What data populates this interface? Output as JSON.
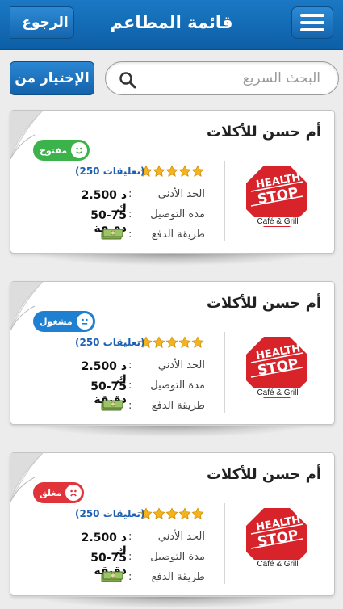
{
  "header": {
    "title": "قائمة المطاعم",
    "back_label": "الرجوع"
  },
  "search": {
    "placeholder": "البحث السريع",
    "choose_label": "الإختيار من"
  },
  "labels": {
    "min_order": "الحد الأدني",
    "delivery_time": "مدة التوصيل",
    "payment": "طريقة الدفع",
    "colon": ":"
  },
  "logo": {
    "line1": "HEALTH",
    "line2": "STOP",
    "line3": "Café & Grill"
  },
  "restaurants": [
    {
      "name": "أم حسن للأكلات",
      "status": "مفتوح",
      "status_color": "#3bb34a",
      "face": "open-smile-icon",
      "rating": 5,
      "comments": "(250 تعليقات)",
      "min_order": "2.500 د ك",
      "delivery_time": "50-75 دقيقة"
    },
    {
      "name": "أم حسن للأكلات",
      "status": "مشغول",
      "status_color": "#1f7fd0",
      "face": "busy-neutral-icon",
      "rating": 5,
      "comments": "(250 تعليقات)",
      "min_order": "2.500 د ك",
      "delivery_time": "50-75 دقيقة"
    },
    {
      "name": "أم حسن للأكلات",
      "status": "مغلق",
      "status_color": "#e0343a",
      "face": "closed-sad-icon",
      "rating": 5,
      "comments": "(250 تعليقات)",
      "min_order": "2.500 د ك",
      "delivery_time": "50-75 دقيقة"
    }
  ],
  "colors": {
    "header_blue": "#1b78c4",
    "link_blue": "#1e5fb3",
    "star_gold": "#f5b21a"
  }
}
